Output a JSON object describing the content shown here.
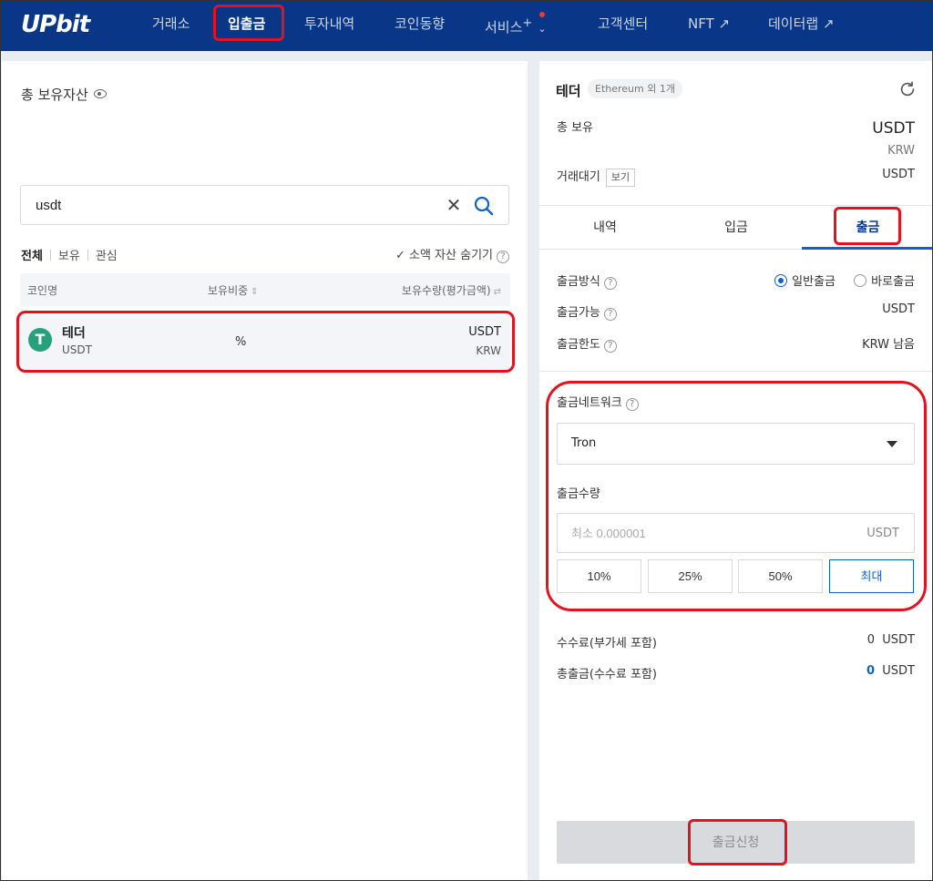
{
  "header": {
    "logo": "UPbit",
    "nav": [
      {
        "label": "거래소"
      },
      {
        "label": "입출금"
      },
      {
        "label": "투자내역"
      },
      {
        "label": "코인동향"
      },
      {
        "label": "서비스",
        "suffix": "+"
      },
      {
        "label": "고객센터"
      },
      {
        "label": "NFT ↗"
      },
      {
        "label": "데이터랩 ↗"
      }
    ]
  },
  "left": {
    "title": "총 보유자산",
    "search": {
      "value": "usdt",
      "placeholder": ""
    },
    "filters": [
      "전체",
      "보유",
      "관심"
    ],
    "hide_small": "소액 자산 숨기기",
    "columns": {
      "name": "코인명",
      "ratio": "보유비중",
      "amount": "보유수량(평가금액)"
    },
    "rows": [
      {
        "name": "테더",
        "symbol": "USDT",
        "ratio": "%",
        "amount": "USDT",
        "krw": "KRW"
      }
    ]
  },
  "right": {
    "coin_name": "테더",
    "network_badge": "Ethereum 외 1개",
    "total_label": "총 보유",
    "total_value": "USDT",
    "total_krw": "KRW",
    "pending_label": "거래대기",
    "pending_btn": "보기",
    "pending_value": "USDT",
    "tabs": [
      "내역",
      "입금",
      "출금"
    ],
    "method_label": "출금방식",
    "method_options": [
      "일반출금",
      "바로출금"
    ],
    "available_label": "출금가능",
    "available_value": "USDT",
    "limit_label": "출금한도",
    "limit_value": "KRW 남음",
    "network_label": "출금네트워크",
    "network_value": "Tron",
    "amount_label": "출금수량",
    "amount_placeholder": "최소 0.000001",
    "amount_unit": "USDT",
    "pct_buttons": [
      "10%",
      "25%",
      "50%",
      "최대"
    ],
    "fee_label": "수수료(부가세 포함)",
    "fee_value": "0",
    "fee_unit": "USDT",
    "total_out_label": "총출금(수수료 포함)",
    "total_out_value": "0",
    "total_out_unit": "USDT",
    "submit": "출금신청"
  },
  "colors": {
    "header_bg": "#093687",
    "accent": "#1261c4",
    "highlight": "#e1131f",
    "tether": "#26a17b"
  }
}
